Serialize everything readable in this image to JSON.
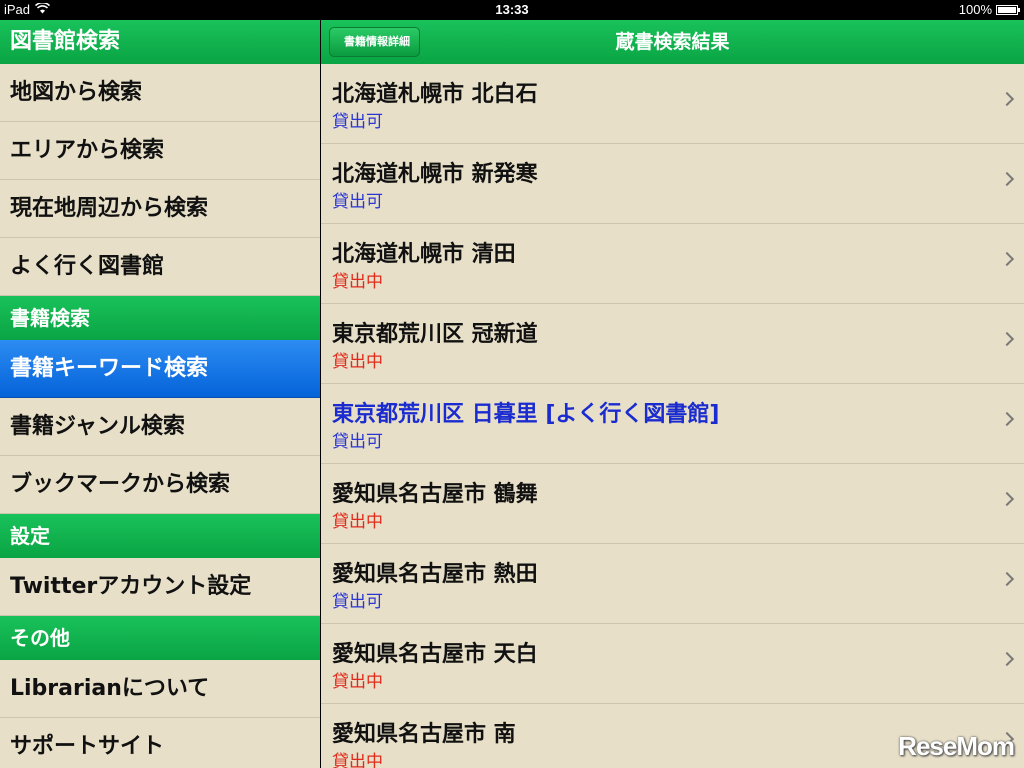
{
  "status_bar": {
    "device": "iPad",
    "time": "13:33",
    "battery": "100%",
    "battery_level": 1.0
  },
  "sidebar": {
    "title": "図書館検索",
    "library_items": [
      {
        "label": "地図から検索"
      },
      {
        "label": "エリアから検索"
      },
      {
        "label": "現在地周辺から検索"
      },
      {
        "label": "よく行く図書館"
      }
    ],
    "book_section": "書籍検索",
    "book_items": [
      {
        "label": "書籍キーワード検索",
        "selected": true
      },
      {
        "label": "書籍ジャンル検索"
      },
      {
        "label": "ブックマークから検索"
      }
    ],
    "settings_section": "設定",
    "settings_items": [
      {
        "label": "Twitterアカウント設定"
      }
    ],
    "other_section": "その他",
    "other_items": [
      {
        "label": "Librarianについて"
      },
      {
        "label": "サポートサイト"
      }
    ]
  },
  "navbar": {
    "back_label": "書籍情報詳細",
    "title": "蔵書検索結果"
  },
  "results": [
    {
      "name": "北海道札幌市 北白石",
      "status": "貸出可"
    },
    {
      "name": "北海道札幌市 新発寒",
      "status": "貸出可"
    },
    {
      "name": "北海道札幌市 清田",
      "status": "貸出中"
    },
    {
      "name": "東京都荒川区 冠新道",
      "status": "貸出中"
    },
    {
      "name": "東京都荒川区 日暮里 [よく行く図書館]",
      "status": "貸出可",
      "favorite": true
    },
    {
      "name": "愛知県名古屋市 鶴舞",
      "status": "貸出中"
    },
    {
      "name": "愛知県名古屋市 熱田",
      "status": "貸出可"
    },
    {
      "name": "愛知県名古屋市 天白",
      "status": "貸出中"
    },
    {
      "name": "愛知県名古屋市 南",
      "status": "貸出中"
    }
  ],
  "colors": {
    "accent_green": "#0aa444",
    "selected_blue": "#0563d9",
    "available": "#2a35d6",
    "checked_out": "#e12a1c",
    "background": "#e7dfc8"
  },
  "watermark": "ReseMom"
}
